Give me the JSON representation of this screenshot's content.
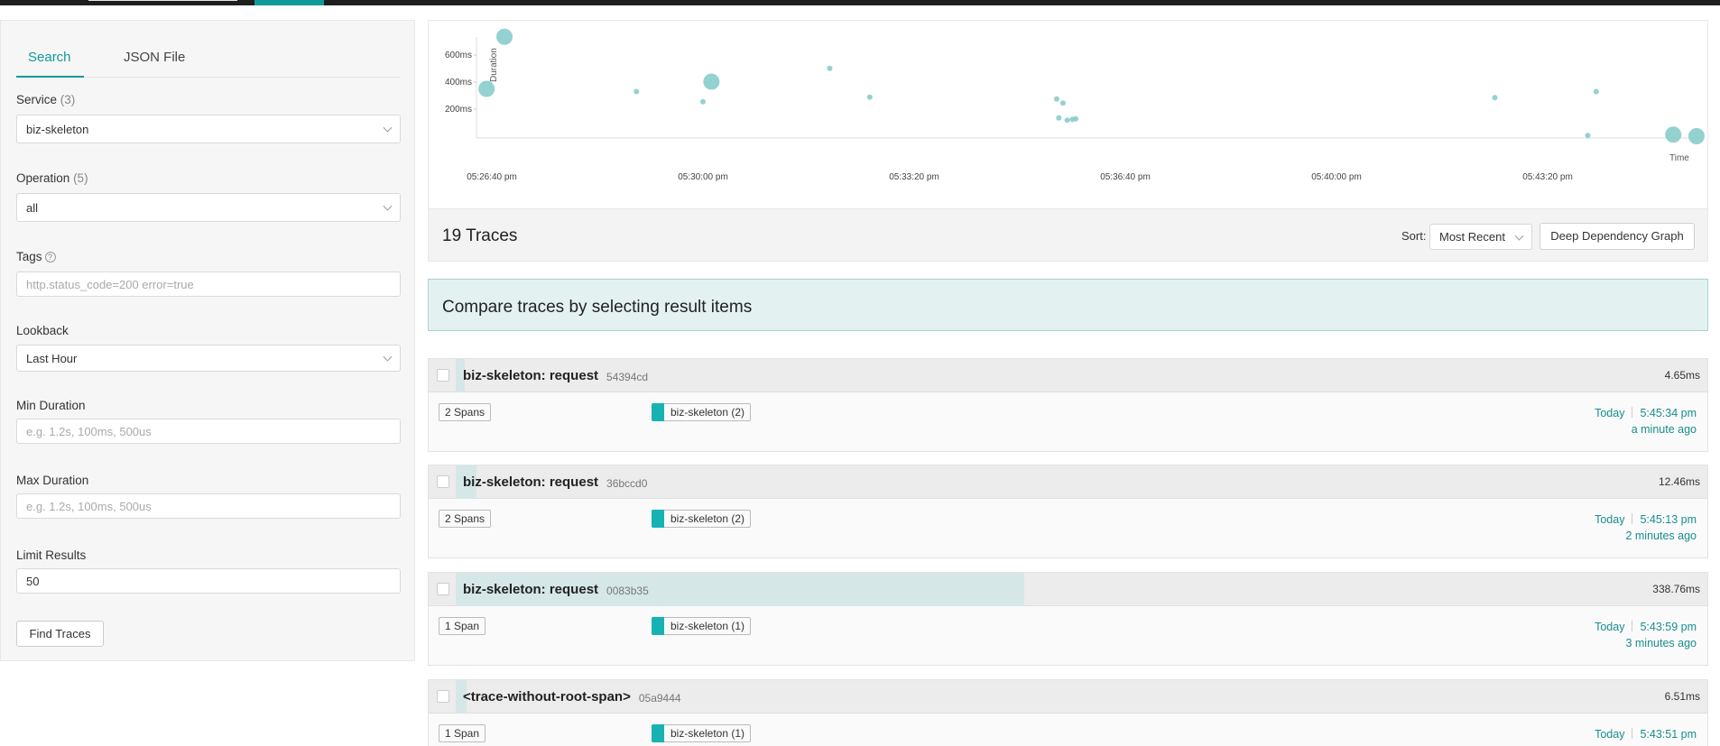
{
  "topbar": {},
  "search_panel": {
    "tabs": [
      {
        "label": "Search"
      },
      {
        "label": "JSON File"
      }
    ],
    "service": {
      "label": "Service",
      "count": "(3)",
      "value": "biz-skeleton"
    },
    "operation": {
      "label": "Operation",
      "count": "(5)",
      "value": "all"
    },
    "tags": {
      "label": "Tags",
      "placeholder": "http.status_code=200 error=true"
    },
    "lookback": {
      "label": "Lookback",
      "value": "Last Hour"
    },
    "min_duration": {
      "label": "Min Duration",
      "placeholder": "e.g. 1.2s, 100ms, 500us"
    },
    "max_duration": {
      "label": "Max Duration",
      "placeholder": "e.g. 1.2s, 100ms, 500us"
    },
    "limit": {
      "label": "Limit Results",
      "value": "50"
    },
    "find_button": "Find Traces"
  },
  "chart_data": {
    "type": "scatter",
    "ylabel": "Duration",
    "xlabel": "Time",
    "y_ticks": [
      "200ms",
      "400ms",
      "600ms"
    ],
    "x_ticks": [
      "05:26:40 pm",
      "05:30:00 pm",
      "05:33:20 pm",
      "05:36:40 pm",
      "05:40:00 pm",
      "05:43:20 pm"
    ],
    "point_color": "#88cccc",
    "xlim_seconds_from_tick0": [
      -15,
      1150
    ],
    "ylim_ms": [
      0,
      750
    ],
    "points": [
      {
        "t": 12,
        "ms": 735,
        "r": 9
      },
      {
        "t": -5,
        "ms": 350,
        "r": 9
      },
      {
        "t": 137,
        "ms": 330,
        "r": 3
      },
      {
        "t": 200,
        "ms": 255,
        "r": 3
      },
      {
        "t": 208,
        "ms": 403,
        "r": 9
      },
      {
        "t": 320,
        "ms": 502,
        "r": 3
      },
      {
        "t": 358,
        "ms": 288,
        "r": 3
      },
      {
        "t": 535,
        "ms": 275,
        "r": 3
      },
      {
        "t": 541,
        "ms": 245,
        "r": 3
      },
      {
        "t": 537,
        "ms": 135,
        "r": 3
      },
      {
        "t": 545,
        "ms": 118,
        "r": 3
      },
      {
        "t": 550,
        "ms": 125,
        "r": 3
      },
      {
        "t": 553,
        "ms": 128,
        "r": 3
      },
      {
        "t": 950,
        "ms": 285,
        "r": 3
      },
      {
        "t": 1046,
        "ms": 330,
        "r": 3
      },
      {
        "t": 1038,
        "ms": 6,
        "r": 3
      },
      {
        "t": 1119,
        "ms": 12,
        "r": 9
      },
      {
        "t": 1141,
        "ms": 0,
        "r": 9
      }
    ]
  },
  "summary": {
    "count": "19 Traces",
    "sort_label": "Sort:",
    "sort_value": "Most Recent",
    "ddg_button": "Deep Dependency Graph"
  },
  "compare_banner": "Compare traces by selecting result items",
  "traces": [
    {
      "name": "biz-skeleton: request",
      "id": "54394cd",
      "duration": "4.65ms",
      "spans": "2 Spans",
      "service": "biz-skeleton (2)",
      "day": "Today",
      "time": "5:45:34 pm",
      "ago": "a minute ago",
      "bar_fraction": 0.0137
    },
    {
      "name": "biz-skeleton: request",
      "id": "36bccd0",
      "duration": "12.46ms",
      "spans": "2 Spans",
      "service": "biz-skeleton (2)",
      "day": "Today",
      "time": "5:45:13 pm",
      "ago": "2 minutes ago",
      "bar_fraction": 0.0368
    },
    {
      "name": "biz-skeleton: request",
      "id": "0083b35",
      "duration": "338.76ms",
      "spans": "1 Span",
      "service": "biz-skeleton (1)",
      "day": "Today",
      "time": "5:43:59 pm",
      "ago": "3 minutes ago",
      "bar_fraction": 1.0
    },
    {
      "name": "<trace-without-root-span>",
      "id": "05a9444",
      "duration": "6.51ms",
      "spans": "1 Span",
      "service": "biz-skeleton (1)",
      "day": "Today",
      "time": "5:43:51 pm",
      "ago": "",
      "bar_fraction": 0.0192
    }
  ]
}
